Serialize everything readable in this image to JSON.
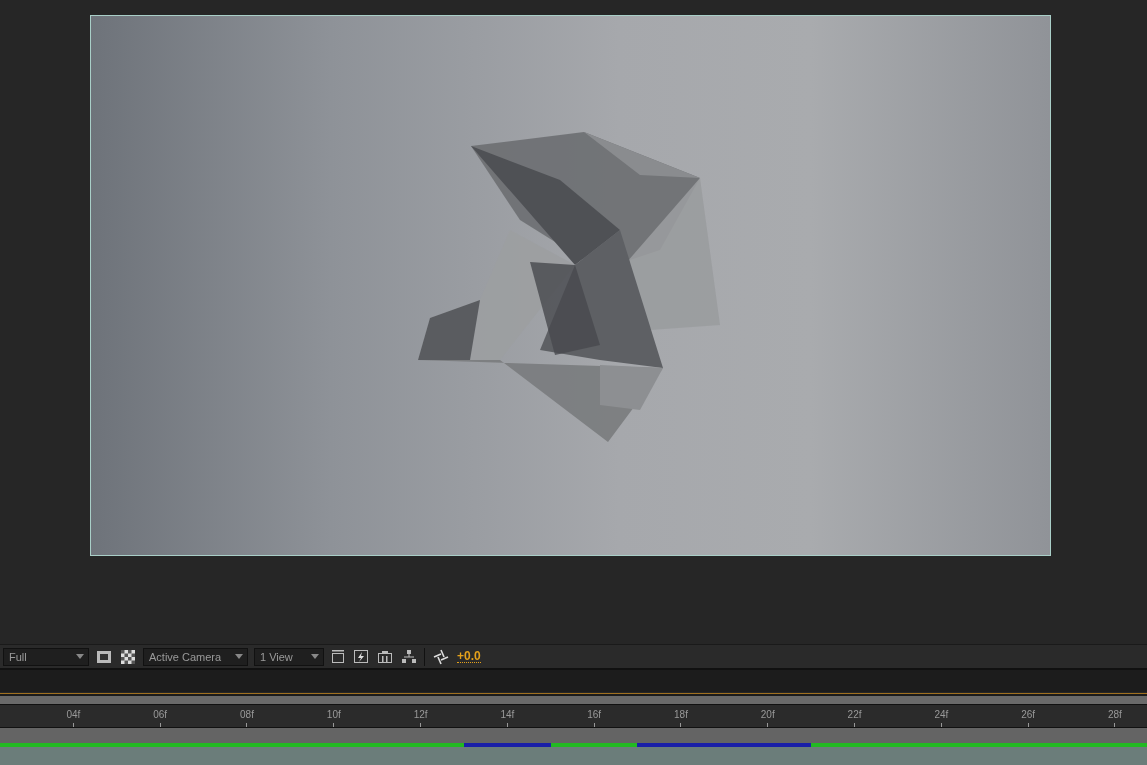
{
  "viewer_toolbar": {
    "resolution": "Full",
    "camera": "Active Camera",
    "views": "1 View",
    "exposure": "+0.0"
  },
  "timeline": {
    "ruler_ticks": [
      "04f",
      "06f",
      "08f",
      "10f",
      "12f",
      "14f",
      "16f",
      "18f",
      "20f",
      "22f",
      "24f",
      "26f",
      "28f"
    ]
  }
}
